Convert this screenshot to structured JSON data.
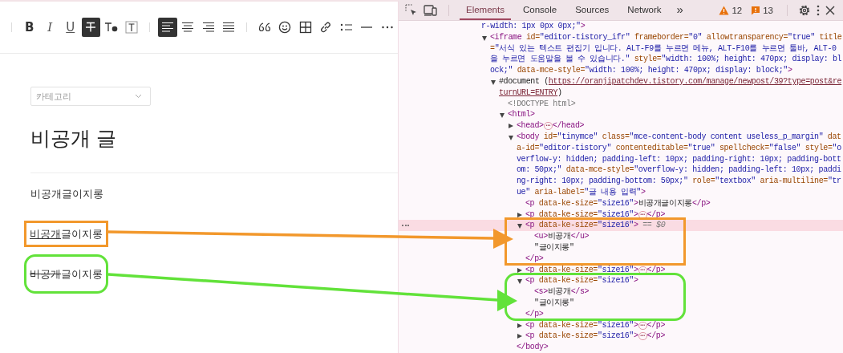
{
  "editor": {
    "toolbar": [
      [
        {
          "kind": "bold",
          "label": "B",
          "selected": false
        },
        {
          "kind": "italic",
          "label": "I",
          "selected": false
        },
        {
          "kind": "underline",
          "label": "U",
          "selected": false
        },
        {
          "kind": "strike",
          "selected": true
        },
        {
          "kind": "text-color",
          "selected": false
        },
        {
          "kind": "text-box",
          "selected": false
        }
      ],
      [
        {
          "kind": "align-left",
          "selected": true
        },
        {
          "kind": "align-center",
          "selected": false
        },
        {
          "kind": "align-right",
          "selected": false
        },
        {
          "kind": "justify",
          "selected": false
        }
      ],
      [
        {
          "kind": "quote",
          "selected": false
        },
        {
          "kind": "emoji",
          "selected": false
        },
        {
          "kind": "table",
          "selected": false
        },
        {
          "kind": "link",
          "selected": false
        },
        {
          "kind": "list",
          "selected": false
        },
        {
          "kind": "rule",
          "selected": false
        },
        {
          "kind": "more",
          "selected": false
        }
      ]
    ],
    "category": {
      "placeholder": "카테고리"
    },
    "title": "비공개 글",
    "paragraphs": [
      {
        "segments": [
          {
            "kind": "plain",
            "text": "비공개글이지롱"
          }
        ]
      },
      {
        "highlight": {
          "kind": "box",
          "color": "#f2982c"
        },
        "segments": [
          {
            "kind": "underline",
            "text": "비공개"
          },
          {
            "kind": "plain",
            "text": "글이지롱"
          }
        ]
      },
      {
        "highlight": {
          "kind": "pill",
          "color": "#62e23a"
        },
        "segments": [
          {
            "kind": "strike",
            "text": "비공개"
          },
          {
            "kind": "plain",
            "text": "글이지롱"
          }
        ]
      }
    ]
  },
  "devtools": {
    "tabs": [
      {
        "label": "Elements",
        "selected": true
      },
      {
        "label": "Console",
        "selected": false
      },
      {
        "label": "Sources",
        "selected": false
      },
      {
        "label": "Network",
        "selected": false
      }
    ],
    "overflow": "»",
    "warnings": "12",
    "issues": "13",
    "wrapped_tail": [
      {
        "kind": "val",
        "text": "r-width: 1px 0px 0px;\""
      },
      {
        "kind": "tag",
        "text": ">"
      }
    ],
    "nodes": [
      {
        "expanded": true,
        "selected": false,
        "tokens": [
          {
            "kind": "tag",
            "text": "<iframe"
          },
          {
            "kind": "attr",
            "text": " id="
          },
          {
            "kind": "val",
            "text": "\"editor-tistory_ifr\""
          },
          {
            "kind": "attr",
            "text": " frameborder="
          },
          {
            "kind": "val",
            "text": "\"0\""
          },
          {
            "kind": "attr",
            "text": " allowtransparency="
          },
          {
            "kind": "val",
            "text": "\"true\""
          },
          {
            "kind": "attr",
            "text": " title="
          },
          {
            "kind": "val",
            "text": "\"서식 있는 텍스트 편집기 입니다. ALT-F9를 누르면 메뉴, ALT-F10를 누르면 툴바, ALT-0을 누르면 도움말을 볼 수 있습니다.\""
          },
          {
            "kind": "attr",
            "text": " style="
          },
          {
            "kind": "val",
            "text": "\"width: 100%; height: 470px; display: block;\""
          },
          {
            "kind": "attr",
            "text": " data-mce-style="
          },
          {
            "kind": "val",
            "text": "\"width: 100%; height: 470px; display: block;\""
          },
          {
            "kind": "tag",
            "text": ">"
          }
        ],
        "children": [
          {
            "expanded": true,
            "selected": false,
            "tokens": [
              {
                "kind": "text",
                "text": "#document ("
              },
              {
                "kind": "link",
                "text": "https://oranjipatchdev.tistory.com/manage/newpost/39?type=post&returnURL=ENTRY"
              },
              {
                "kind": "text",
                "text": ")"
              }
            ],
            "children": [
              {
                "selected": false,
                "tokens": [
                  {
                    "kind": "doctype",
                    "text": "<!DOCTYPE html>"
                  }
                ]
              },
              {
                "expanded": true,
                "selected": false,
                "tokens": [
                  {
                    "kind": "tag",
                    "text": "<html>"
                  }
                ],
                "children": [
                  {
                    "expanded": false,
                    "selected": false,
                    "tokens": [
                      {
                        "kind": "tag",
                        "text": "<head>"
                      },
                      {
                        "kind": "badge",
                        "text": "⋯"
                      },
                      {
                        "kind": "tag",
                        "text": "</head>"
                      }
                    ]
                  },
                  {
                    "expanded": true,
                    "selected": false,
                    "close": "</body>",
                    "tokens": [
                      {
                        "kind": "tag",
                        "text": "<body"
                      },
                      {
                        "kind": "attr",
                        "text": " id="
                      },
                      {
                        "kind": "val",
                        "text": "\"tinymce\""
                      },
                      {
                        "kind": "attr",
                        "text": " class="
                      },
                      {
                        "kind": "val",
                        "text": "\"mce-content-body content useless_p_margin\""
                      },
                      {
                        "kind": "attr",
                        "text": " data-id="
                      },
                      {
                        "kind": "val",
                        "text": "\"editor-tistory\""
                      },
                      {
                        "kind": "attr",
                        "text": " contenteditable="
                      },
                      {
                        "kind": "val",
                        "text": "\"true\""
                      },
                      {
                        "kind": "attr",
                        "text": " spellcheck="
                      },
                      {
                        "kind": "val",
                        "text": "\"false\""
                      },
                      {
                        "kind": "attr",
                        "text": " style="
                      },
                      {
                        "kind": "val",
                        "text": "\"overflow-y: hidden; padding-left: 10px; padding-right: 10px; padding-bottom: 50px;\""
                      },
                      {
                        "kind": "attr",
                        "text": " data-mce-style="
                      },
                      {
                        "kind": "val",
                        "text": "\"overflow-y: hidden; padding-left: 10px; padding-right: 10px; padding-bottom: 50px;\""
                      },
                      {
                        "kind": "attr",
                        "text": " role="
                      },
                      {
                        "kind": "val",
                        "text": "\"textbox\""
                      },
                      {
                        "kind": "attr",
                        "text": " aria-multiline="
                      },
                      {
                        "kind": "val",
                        "text": "\"true\""
                      },
                      {
                        "kind": "attr",
                        "text": " aria-label="
                      },
                      {
                        "kind": "val",
                        "text": "\"글 내용 입력\""
                      },
                      {
                        "kind": "tag",
                        "text": ">"
                      }
                    ],
                    "children": [
                      {
                        "selected": false,
                        "tokens": [
                          {
                            "kind": "tag",
                            "text": "<p"
                          },
                          {
                            "kind": "attr",
                            "text": " data-ke-size="
                          },
                          {
                            "kind": "val",
                            "text": "\"size16\""
                          },
                          {
                            "kind": "tag",
                            "text": ">"
                          },
                          {
                            "kind": "text",
                            "text": "비공개글이지롱"
                          },
                          {
                            "kind": "tag",
                            "text": "</p>"
                          }
                        ]
                      },
                      {
                        "expanded": false,
                        "selected": false,
                        "tokens": [
                          {
                            "kind": "tag",
                            "text": "<p"
                          },
                          {
                            "kind": "attr",
                            "text": " data-ke-size="
                          },
                          {
                            "kind": "val",
                            "text": "\"size16\""
                          },
                          {
                            "kind": "tag",
                            "text": ">"
                          },
                          {
                            "kind": "badge",
                            "text": "⋯"
                          },
                          {
                            "kind": "tag",
                            "text": "</p>"
                          }
                        ]
                      },
                      {
                        "expanded": true,
                        "selected": true,
                        "highlight": {
                          "kind": "box",
                          "color": "#f2982c"
                        },
                        "close": "</p>",
                        "tokens": [
                          {
                            "kind": "tag",
                            "text": "<p"
                          },
                          {
                            "kind": "attr",
                            "text": " data-ke-size="
                          },
                          {
                            "kind": "val",
                            "text": "\"size16\""
                          },
                          {
                            "kind": "tag",
                            "text": ">"
                          },
                          {
                            "kind": "hint",
                            "text": " == $0"
                          }
                        ],
                        "children": [
                          {
                            "selected": false,
                            "tokens": [
                              {
                                "kind": "tag",
                                "text": "<u>"
                              },
                              {
                                "kind": "text",
                                "text": "비공개"
                              },
                              {
                                "kind": "tag",
                                "text": "</u>"
                              }
                            ]
                          },
                          {
                            "selected": false,
                            "tokens": [
                              {
                                "kind": "text",
                                "text": "\"글이지롱\""
                              }
                            ]
                          }
                        ]
                      },
                      {
                        "expanded": false,
                        "selected": false,
                        "tokens": [
                          {
                            "kind": "tag",
                            "text": "<p"
                          },
                          {
                            "kind": "attr",
                            "text": " data-ke-size="
                          },
                          {
                            "kind": "val",
                            "text": "\"size16\""
                          },
                          {
                            "kind": "tag",
                            "text": ">"
                          },
                          {
                            "kind": "badge",
                            "text": "⋯"
                          },
                          {
                            "kind": "tag",
                            "text": "</p>"
                          }
                        ]
                      },
                      {
                        "expanded": true,
                        "selected": false,
                        "highlight": {
                          "kind": "pill",
                          "color": "#62e23a"
                        },
                        "close": "</p>",
                        "tokens": [
                          {
                            "kind": "tag",
                            "text": "<p"
                          },
                          {
                            "kind": "attr",
                            "text": " data-ke-size="
                          },
                          {
                            "kind": "val",
                            "text": "\"size16\""
                          },
                          {
                            "kind": "tag",
                            "text": ">"
                          }
                        ],
                        "children": [
                          {
                            "selected": false,
                            "tokens": [
                              {
                                "kind": "tag",
                                "text": "<s>"
                              },
                              {
                                "kind": "text",
                                "text": "비공개"
                              },
                              {
                                "kind": "tag",
                                "text": "</s>"
                              }
                            ]
                          },
                          {
                            "selected": false,
                            "tokens": [
                              {
                                "kind": "text",
                                "text": "\"글이지롱\""
                              }
                            ]
                          }
                        ]
                      },
                      {
                        "expanded": false,
                        "selected": false,
                        "tokens": [
                          {
                            "kind": "tag",
                            "text": "<p"
                          },
                          {
                            "kind": "attr",
                            "text": " data-ke-size="
                          },
                          {
                            "kind": "val",
                            "text": "\"size16\""
                          },
                          {
                            "kind": "tag",
                            "text": ">"
                          },
                          {
                            "kind": "badge",
                            "text": "⋯"
                          },
                          {
                            "kind": "tag",
                            "text": "</p>"
                          }
                        ]
                      },
                      {
                        "expanded": false,
                        "selected": false,
                        "tokens": [
                          {
                            "kind": "tag",
                            "text": "<p"
                          },
                          {
                            "kind": "attr",
                            "text": " data-ke-size="
                          },
                          {
                            "kind": "val",
                            "text": "\"size16\""
                          },
                          {
                            "kind": "tag",
                            "text": ">"
                          },
                          {
                            "kind": "badge",
                            "text": "⋯"
                          },
                          {
                            "kind": "tag",
                            "text": "</p>"
                          }
                        ]
                      }
                    ]
                  }
                ]
              }
            ]
          }
        ]
      }
    ]
  }
}
